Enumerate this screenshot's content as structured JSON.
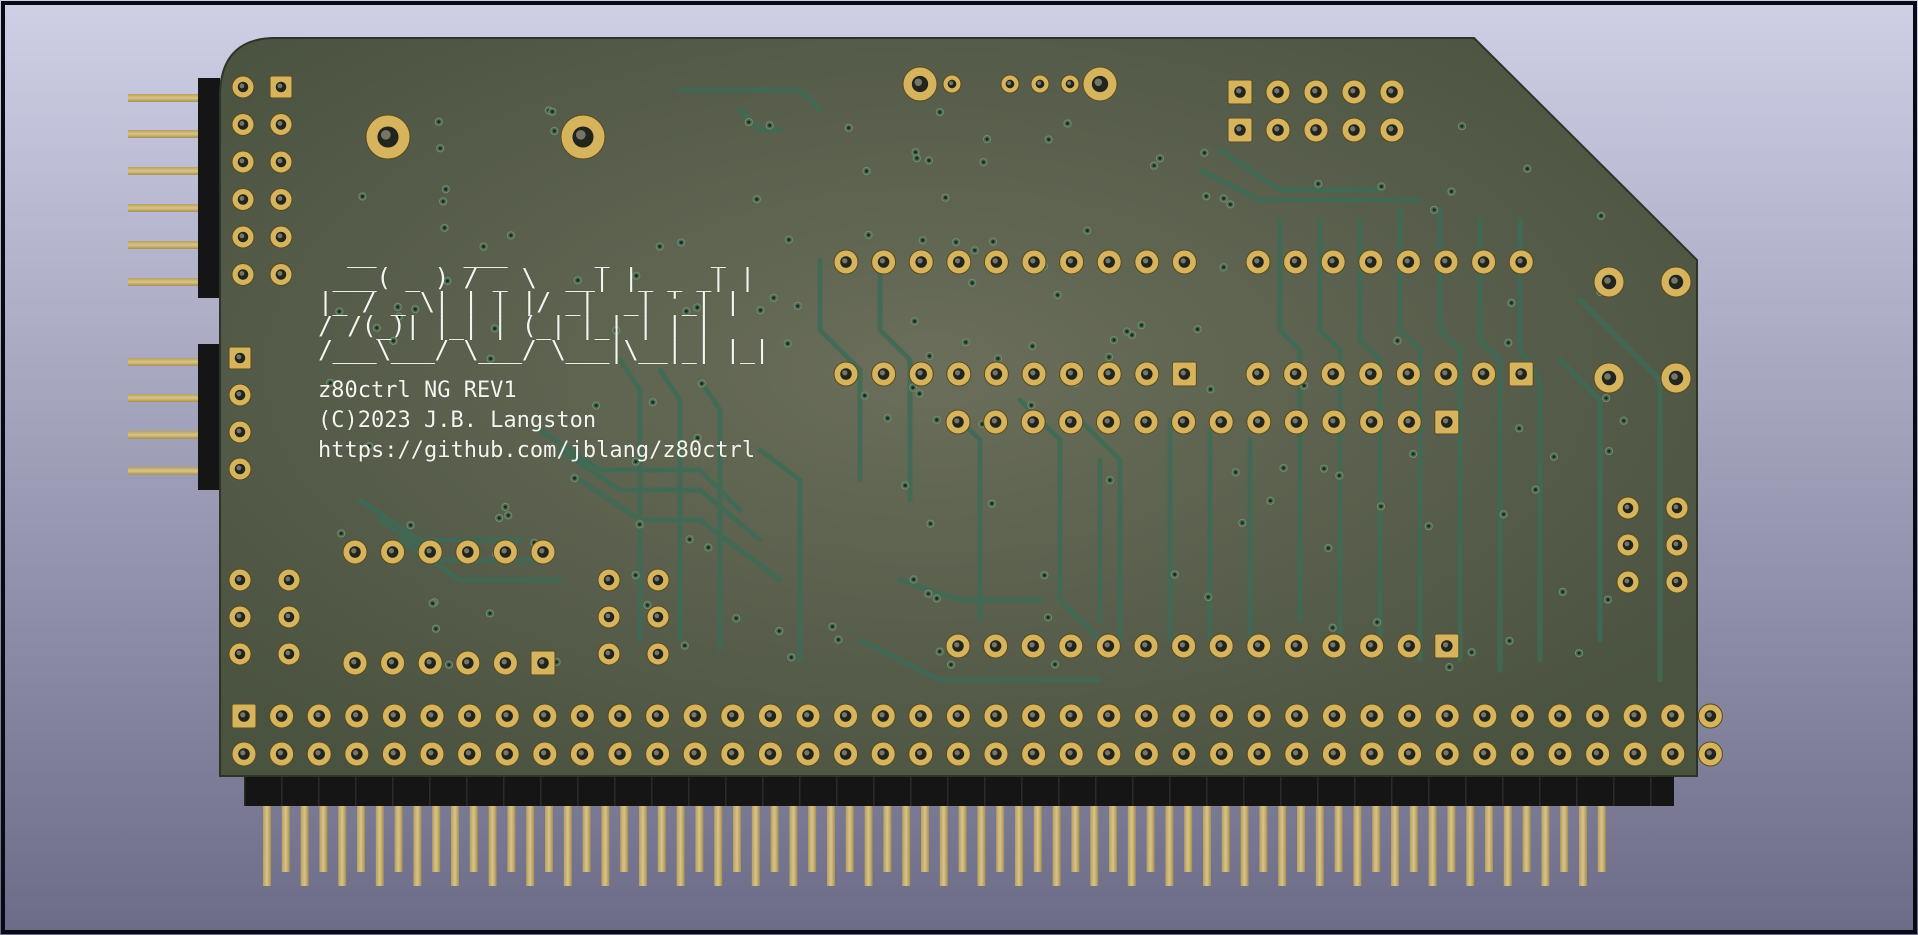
{
  "colors": {
    "background_top": "#cfcfe6",
    "background_bottom": "#6c6c88",
    "solder_mask": "#4a5240",
    "solder_mask_light": "#6a6e5a",
    "trace": "#3e6b56",
    "copper_pad": "#d6b45e",
    "pad_ring_dark": "#5a4a1c",
    "drill": "#22251c",
    "pin_gold": "#d8c48a",
    "header_plastic": "#151515",
    "silkscreen": "#f4f4f0"
  },
  "silkscreen": {
    "logo_ascii": "  __      ___      _       _ \n ___( _ ) / _ \\  __| |_ _ _| |\n|_ / _ \\| | | |/ _|  _| '_| |\n/ /(_)| |_| | (_| |_| | | |\n/___\\___/ \\___/ \\___|\\__|_| |_|",
    "name": "z80ctrl NG REV1",
    "copyright": "(C)2023 J.B. Langston",
    "url": "https://github.com/jblang/z80ctrl"
  },
  "icons": {
    "board": "pcb-board-icon",
    "pad": "solder-pad-icon",
    "pin": "header-pin-icon"
  }
}
